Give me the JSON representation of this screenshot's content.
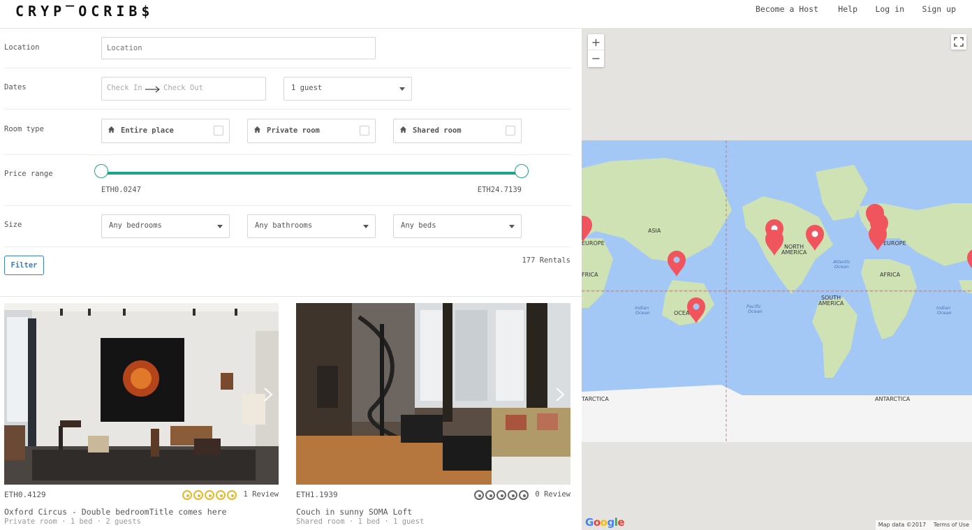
{
  "header": {
    "logo": "CRYP‾OCRIB$",
    "nav": [
      {
        "label": "Become a Host"
      },
      {
        "label": "Help"
      },
      {
        "label": "Log in"
      },
      {
        "label": "Sign up"
      }
    ]
  },
  "filters": {
    "location": {
      "label": "Location",
      "placeholder": "Location"
    },
    "dates": {
      "label": "Dates",
      "check_in": "Check In",
      "check_out": "Check Out",
      "guests": "1 guest"
    },
    "room_type": {
      "label": "Room type",
      "options": [
        {
          "label": "Entire place",
          "checked": false
        },
        {
          "label": "Private room",
          "checked": false
        },
        {
          "label": "Shared room",
          "checked": false
        }
      ]
    },
    "price": {
      "label": "Price range",
      "min_label": "ETH0.0247",
      "max_label": "ETH24.7139",
      "low_fraction": 0,
      "high_fraction": 1
    },
    "size": {
      "label": "Size",
      "bedrooms": "Any bedrooms",
      "bathrooms": "Any bathrooms",
      "beds": "Any beds"
    },
    "filter_button": "Filter",
    "result_count": "177 Rentals"
  },
  "listings": [
    {
      "price": "ETH0.4129",
      "rating": 5,
      "reviews": "1 Review",
      "title": "Oxford Circus - Double bedroomTitle comes here",
      "meta": "Private room · 1 bed · 2 guests"
    },
    {
      "price": "ETH1.1939",
      "rating": 0,
      "reviews": "0 Review",
      "title": "Couch in sunny SOMA Loft",
      "meta": "Shared room · 1 bed · 1 guest"
    }
  ],
  "map": {
    "labels": {
      "asia": "ASIA",
      "europe_left": "EUROPE",
      "africa_left": "FRICA",
      "north_america_1": "NORTH",
      "north_america_2": "AMERICA",
      "europe_right": "EUROPE",
      "africa_right": "AFRICA",
      "south_america_1": "SOUTH",
      "south_america_2": "AMERICA",
      "atlantic_1": "Atlantic",
      "atlantic_2": "Ocean",
      "pacific_1": "Pacific",
      "pacific_2": "Ocean",
      "indian_left_1": "Indian",
      "indian_left_2": "Ocean",
      "indian_right_1": "Indian",
      "indian_right_2": "Ocean",
      "oceania": "OCEA",
      "antarctica_left": "TARCTICA",
      "antarctica_right": "ANTARCTICA"
    },
    "zoom_in": "+",
    "zoom_out": "−",
    "google": "Google",
    "attribution": "Map data ©2017",
    "terms": "Terms of Use"
  },
  "colors": {
    "accent": "#18a589",
    "link": "#3b7fc4",
    "marker": "#f0545d",
    "star": "#e4b82a",
    "water": "#a4c8f5",
    "land": "#cfe2b4"
  }
}
